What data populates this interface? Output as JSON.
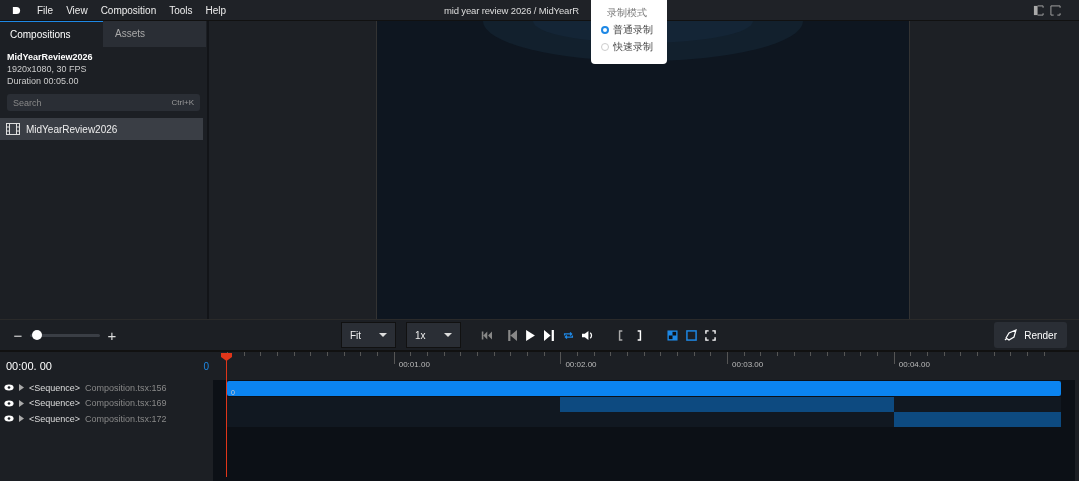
{
  "menu": [
    "File",
    "View",
    "Composition",
    "Tools",
    "Help"
  ],
  "window": {
    "title": "mid year review 2026 / MidYearR"
  },
  "record_popover": {
    "title": "录制模式",
    "options": [
      {
        "label": "普通录制",
        "selected": true
      },
      {
        "label": "快速录制",
        "selected": false
      }
    ]
  },
  "tabs": [
    {
      "label": "Compositions",
      "selected": true
    },
    {
      "label": "Assets",
      "selected": false
    }
  ],
  "composition": {
    "name": "MidYearReview2026",
    "format": "1920x1080, 30 FPS",
    "duration": "Duration 00:05.00"
  },
  "search": {
    "placeholder": "Search",
    "shortcut": "Ctrl+K"
  },
  "composition_list": [
    {
      "label": "MidYearReview2026",
      "selected": true
    }
  ],
  "zoom": {
    "minus": "−",
    "plus": "+",
    "level": 0.1
  },
  "fit_select": "Fit",
  "speed_select": "1x",
  "transport": {
    "loop": true
  },
  "view_toggles": {
    "checkerboard": true,
    "safe_area": true
  },
  "render_button": "Render",
  "timeline": {
    "time": "00:00. 00",
    "frame": "0",
    "ticks": [
      "00:01.00",
      "00:02.00",
      "00:03.00",
      "00:04.00"
    ],
    "tracks": [
      {
        "tag": "<Sequence>",
        "source": "Composition.tsx:156",
        "clip": {
          "level": 1.0,
          "label": "0",
          "selected": true
        }
      },
      {
        "tag": "<Sequence>",
        "source": "Composition.tsx:169",
        "gap": {
          "level": 0.4
        },
        "clip": {
          "level": 0.667,
          "selected": false
        }
      },
      {
        "tag": "<Sequence>",
        "source": "Composition.tsx:172",
        "gap": {
          "level": 0.8
        },
        "clip": {
          "level": 1.0,
          "selected": false
        }
      }
    ]
  }
}
